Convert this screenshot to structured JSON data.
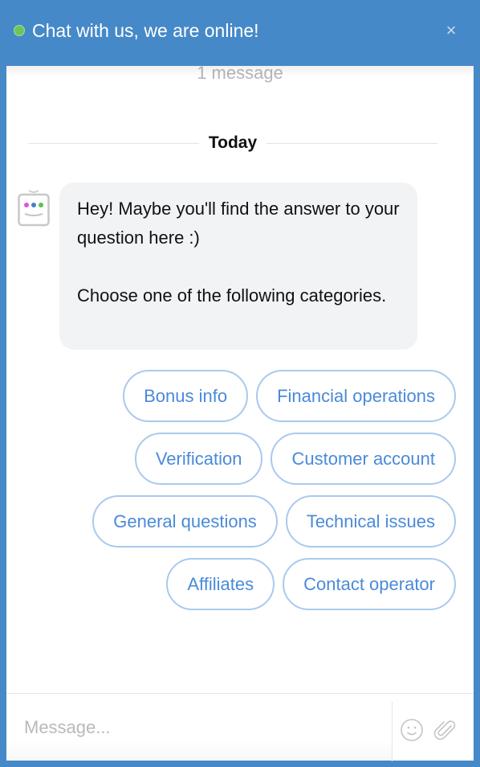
{
  "header": {
    "title": "Chat with us, we are online!",
    "status": "online",
    "status_color": "#6cc65a",
    "close_icon": "×",
    "accent_color": "#4589c8"
  },
  "conversation": {
    "message_count": "1 message",
    "date_separator": "Today",
    "messages": [
      {
        "sender": "bot",
        "avatar_icon": "robot-icon",
        "paragraphs": [
          "Hey! Maybe you'll find the answer to your question here :)",
          "Choose one of the following categories."
        ]
      }
    ],
    "quick_replies": [
      "Bonus info",
      "Financial operations",
      "Verification",
      "Customer account",
      "General questions",
      "Technical issues",
      "Affiliates",
      "Contact operator"
    ],
    "chip_color": "#4a8ad8"
  },
  "composer": {
    "placeholder": "Message...",
    "value": "",
    "emoji_icon": "smiley-icon",
    "attach_icon": "paperclip-icon"
  }
}
